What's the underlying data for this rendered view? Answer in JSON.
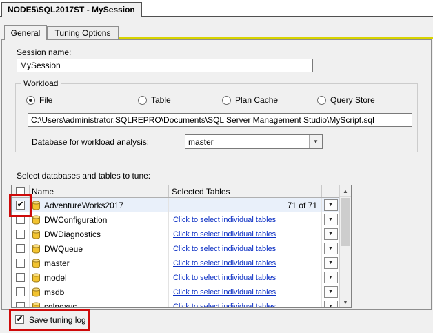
{
  "window": {
    "title_tab": "NODE5\\SQL2017ST - MySession"
  },
  "tabs": {
    "general": "General",
    "tuning_options": "Tuning Options"
  },
  "session": {
    "label": "Session name:",
    "value": "MySession"
  },
  "workload": {
    "group_label": "Workload",
    "options": [
      {
        "label": "File",
        "selected": true
      },
      {
        "label": "Table",
        "selected": false
      },
      {
        "label": "Plan Cache",
        "selected": false
      },
      {
        "label": "Query Store",
        "selected": false
      }
    ],
    "file_path": "C:\\Users\\administrator.SQLREPRO\\Documents\\SQL Server Management Studio\\MyScript.sql",
    "database_label": "Database for workload analysis:",
    "database_value": "master"
  },
  "grid": {
    "caption": "Select databases and tables to tune:",
    "columns": {
      "name": "Name",
      "selected_tables": "Selected Tables"
    },
    "rows": [
      {
        "name": "AdventureWorks2017",
        "checked": true,
        "selected": true,
        "tables": "71 of 71",
        "link": false
      },
      {
        "name": "DWConfiguration",
        "checked": false,
        "selected": false,
        "tables": "Click to select individual tables",
        "link": true
      },
      {
        "name": "DWDiagnostics",
        "checked": false,
        "selected": false,
        "tables": "Click to select individual tables",
        "link": true
      },
      {
        "name": "DWQueue",
        "checked": false,
        "selected": false,
        "tables": "Click to select individual tables",
        "link": true
      },
      {
        "name": "master",
        "checked": false,
        "selected": false,
        "tables": "Click to select individual tables",
        "link": true
      },
      {
        "name": "model",
        "checked": false,
        "selected": false,
        "tables": "Click to select individual tables",
        "link": true
      },
      {
        "name": "msdb",
        "checked": false,
        "selected": false,
        "tables": "Click to select individual tables",
        "link": true
      },
      {
        "name": "sqlnexus",
        "checked": false,
        "selected": false,
        "tables": "Click to select individual tables",
        "link": true
      }
    ]
  },
  "footer": {
    "save_tuning_log": "Save tuning log",
    "checked": true
  },
  "icons": {
    "dropdown_arrow": "▼",
    "up_arrow": "▲",
    "down_arrow": "▼",
    "check": "✔"
  },
  "colors": {
    "annotation_red": "#cf0a0a",
    "link_blue": "#0b2fc4",
    "selected_row_bg": "#e9f0fa",
    "accent_yellow": "#d8d400",
    "db_icon_body": "#f2c330",
    "db_icon_top": "#fadd7d"
  }
}
